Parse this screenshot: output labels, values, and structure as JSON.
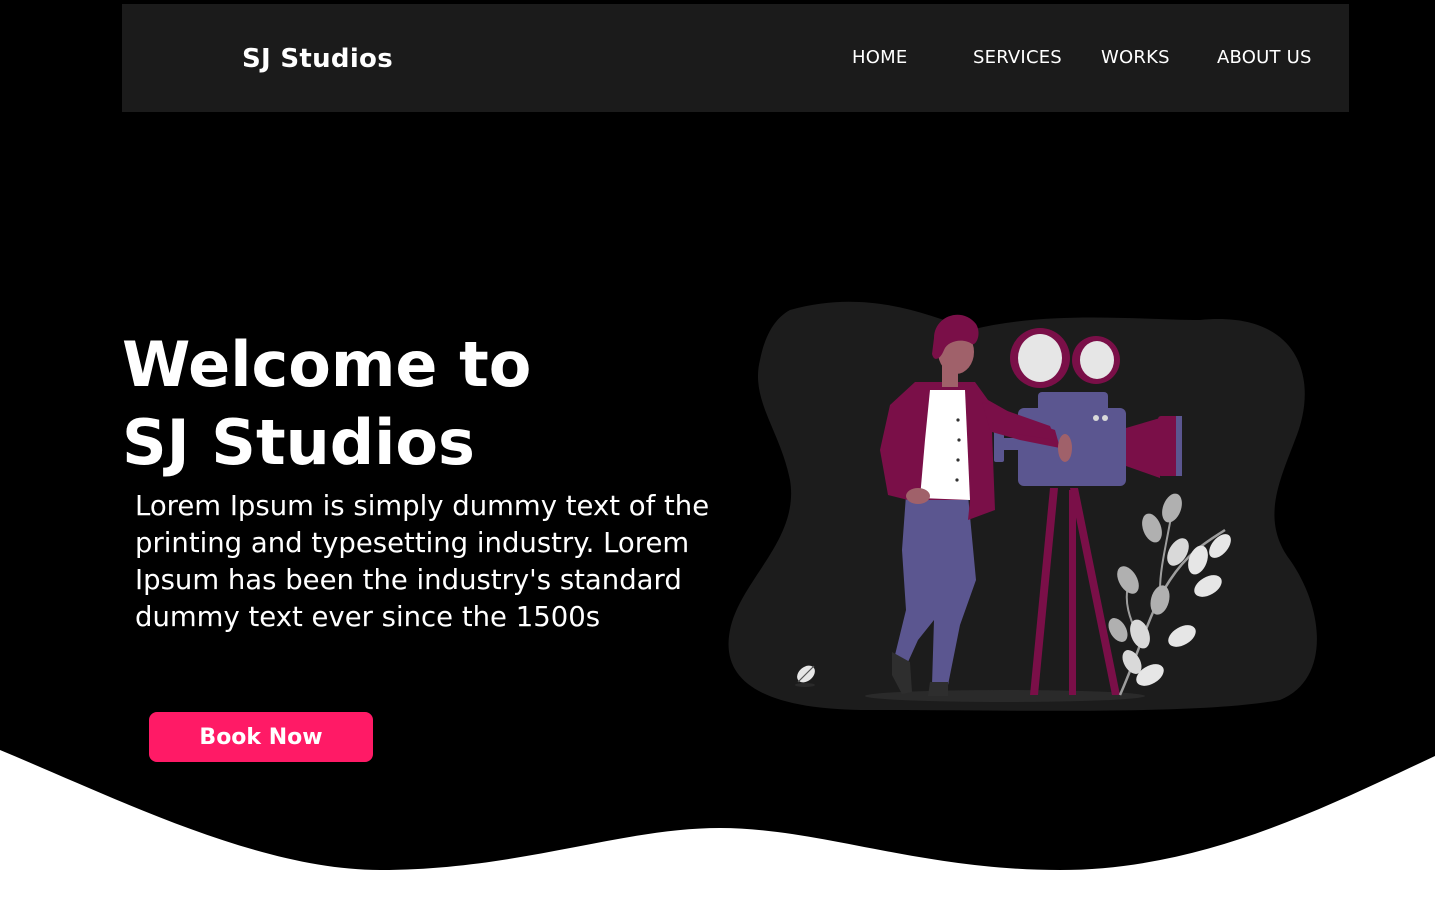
{
  "header": {
    "brand": "SJ Studios",
    "nav": [
      {
        "label": "HOME"
      },
      {
        "label": "SERVICES"
      },
      {
        "label": "WORKS"
      },
      {
        "label": "ABOUT US"
      }
    ]
  },
  "hero": {
    "title_line1": "Welcome to",
    "title_line2": "SJ Studios",
    "description": "Lorem Ipsum is simply dummy text of the printing and typesetting industry. Lorem Ipsum has been the industry's standard dummy text ever since the 1500s",
    "cta_label": "Book Now"
  },
  "colors": {
    "background": "#000000",
    "navbar": "#1b1b1b",
    "accent": "#ff1a66",
    "blob": "#1c1c1c",
    "illustration_maroon": "#7a0f48",
    "illustration_purple": "#5b5690",
    "footer_wave": "#ffffff"
  },
  "illustration": {
    "subject": "videographer-with-film-camera",
    "icons": [
      "person-illustration",
      "film-camera-illustration",
      "plant-illustration",
      "leaf-icon"
    ]
  }
}
